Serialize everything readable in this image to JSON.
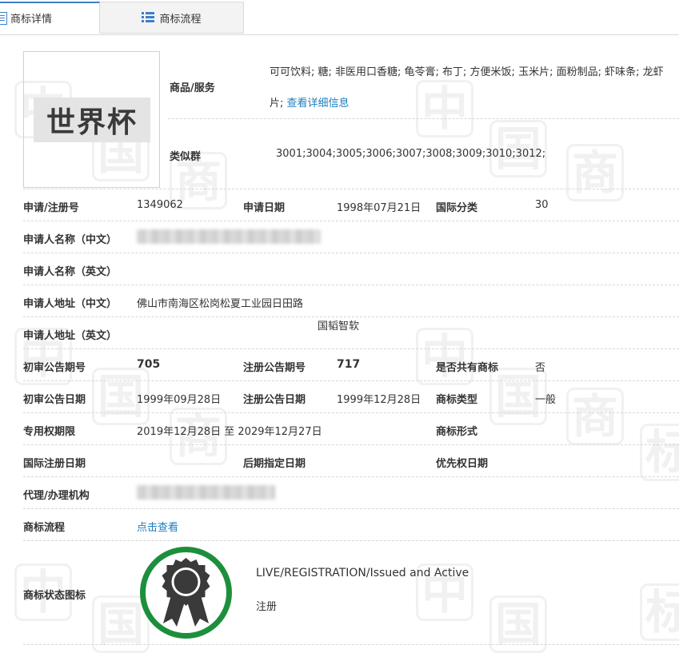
{
  "tabs": [
    {
      "label": "商标详情",
      "icon": "document-icon"
    },
    {
      "label": "商标流程",
      "icon": "list-icon"
    }
  ],
  "logo": {
    "text": "世界杯"
  },
  "goods": {
    "label": "商品/服务",
    "line1": "可可饮料; 糖; 非医用口香糖; 龟苓膏; 布丁; 方便米饭; 玉米片; 面粉制品; 虾味条; 龙虾",
    "line2_prefix": "片;",
    "detail_link": "查看详细信息"
  },
  "similar": {
    "label": "类似群",
    "value": "3001;3004;3005;3006;3007;3008;3009;3010;3012;"
  },
  "fields": {
    "reg_no_label": "申请/注册号",
    "reg_no": "1349062",
    "apply_date_label": "申请日期",
    "apply_date": "1998年07月21日",
    "intl_class_label": "国际分类",
    "intl_class": "30",
    "applicant_cn_label": "申请人名称（中文）",
    "applicant_en_label": "申请人名称（英文）",
    "addr_cn_label": "申请人地址（中文）",
    "addr_cn": "佛山市南海区松岗松夏工业园日田路",
    "addr_en_label": "申请人地址（英文）",
    "addr_en": "国韬智软",
    "prelim_no_label": "初审公告期号",
    "prelim_no": "705",
    "reg_pub_no_label": "注册公告期号",
    "reg_pub_no": "717",
    "shared_label": "是否共有商标",
    "shared": "否",
    "prelim_date_label": "初审公告日期",
    "prelim_date": "1999年09月28日",
    "reg_pub_date_label": "注册公告日期",
    "reg_pub_date": "1999年12月28日",
    "type_label": "商标类型",
    "type": "一般",
    "term_label": "专用权期限",
    "term": "2019年12月28日 至 2029年12月27日",
    "form_label": "商标形式",
    "intl_reg_date_label": "国际注册日期",
    "later_date_label": "后期指定日期",
    "priority_label": "优先权日期",
    "agent_label": "代理/办理机构",
    "process_label": "商标流程",
    "process_link": "点击查看",
    "status_icon_label": "商标状态图标"
  },
  "status": {
    "en": "LIVE/REGISTRATION/Issued and Active",
    "cn": "注册",
    "ring_color": "#1d8f3c",
    "badge_color": "#3a3a3a"
  },
  "colors": {
    "accent": "#3d7fc8",
    "link": "#1a7ec0"
  }
}
